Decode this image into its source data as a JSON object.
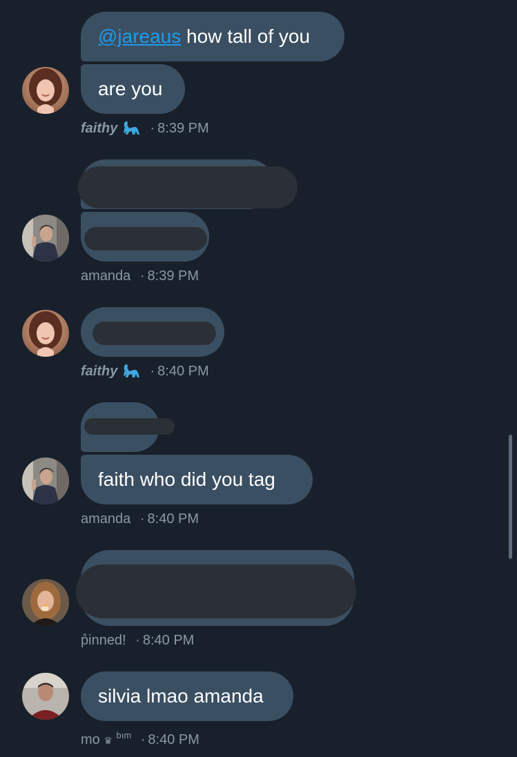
{
  "messages": [
    {
      "mention": "@jareaus",
      "text": " how tall of you"
    },
    {
      "text": "are you"
    },
    {
      "text": "faith who did you tag"
    },
    {
      "text": "silvia lmao amanda"
    }
  ],
  "meta": [
    {
      "sender": "faithy",
      "time": "8:39 PM"
    },
    {
      "sender": "amanda",
      "time": "8:39 PM"
    },
    {
      "sender": "faithy",
      "time": "8:40 PM"
    },
    {
      "sender": "amanda",
      "time": "8:40 PM"
    },
    {
      "sender": "p̊inned!",
      "time": "8:40 PM"
    },
    {
      "sender": "mo",
      "crown": "♛",
      "suffix": "bım",
      "time": "8:40 PM"
    }
  ],
  "separator": "·",
  "icons": {
    "dinosaur": "dinosaur-icon",
    "crown": "crown-icon"
  },
  "colors": {
    "background": "#18202b",
    "bubble": "#3b4f62",
    "mention": "#1d9bf0",
    "meta_text": "#8899a6",
    "redaction": "#2b3036"
  }
}
